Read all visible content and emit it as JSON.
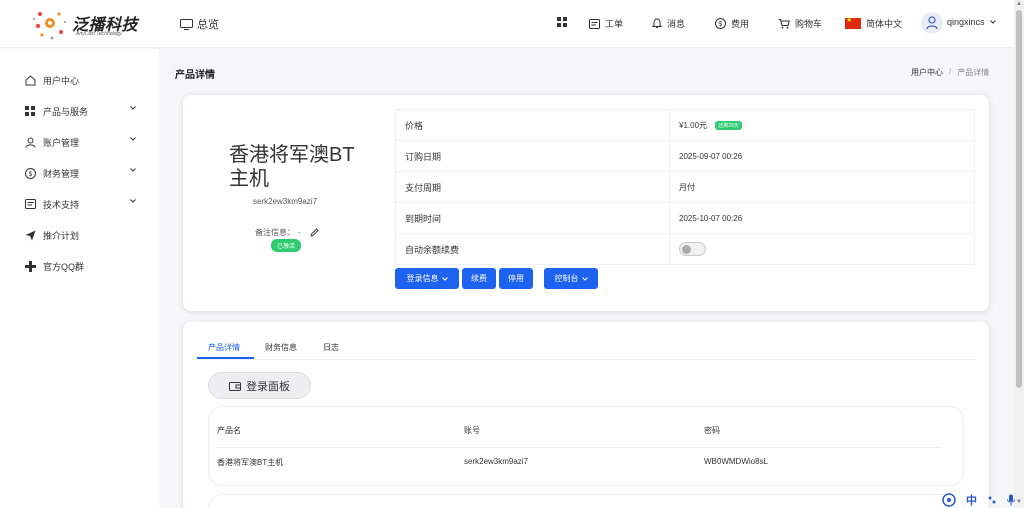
{
  "header": {
    "logo_title": "泛播科技",
    "logo_subtitle": "AnyCast Technology",
    "overview": "总览",
    "nav": {
      "ticket": "工单",
      "message": "消息",
      "fee": "费用",
      "cart": "购物车",
      "language": "简体中文",
      "user": "qingxincs"
    }
  },
  "sidebar": {
    "items": [
      {
        "label": "用户中心",
        "icon": "home-icon"
      },
      {
        "label": "产品与服务",
        "icon": "grid-icon"
      },
      {
        "label": "账户管理",
        "icon": "user-icon"
      },
      {
        "label": "财务管理",
        "icon": "dollar-icon"
      },
      {
        "label": "技术支持",
        "icon": "document-icon"
      },
      {
        "label": "推介计划",
        "icon": "send-icon"
      },
      {
        "label": "官方QQ群",
        "icon": "plus-icon"
      }
    ]
  },
  "page": {
    "title": "产品详情",
    "breadcrumb": {
      "parent": "用户中心",
      "separator": "/",
      "current": "产品详情"
    }
  },
  "product": {
    "name": "香港将军澳BT主机",
    "id": "serk2ew3km9azi7",
    "remark_label": "备注信息：",
    "remark_value": "-",
    "status": "已激活",
    "info": {
      "price_label": "价格",
      "price_value": "¥1.00元",
      "price_badge": "还剩29天",
      "order_date_label": "订购日期",
      "order_date_value": "2025-09-07 00:26",
      "cycle_label": "支付周期",
      "cycle_value": "月付",
      "expire_label": "到期时间",
      "expire_value": "2025-10-07 00:26",
      "auto_renew_label": "自动余额续费"
    },
    "buttons": {
      "login_info": "登录信息",
      "renew": "续费",
      "disable": "停用",
      "console": "控制台"
    }
  },
  "tabs": [
    "产品详情",
    "财务信息",
    "日志"
  ],
  "login_panel": "登录面板",
  "account_table": {
    "headers": [
      "产品名",
      "账号",
      "密码"
    ],
    "row": [
      "香港将军澳BT主机",
      "serk2ew3km9azi7",
      "WB0WMDWio8sL"
    ]
  },
  "ime": {
    "lang": "中"
  },
  "colors": {
    "primary": "#1e62f0",
    "success": "#2ecc71"
  }
}
